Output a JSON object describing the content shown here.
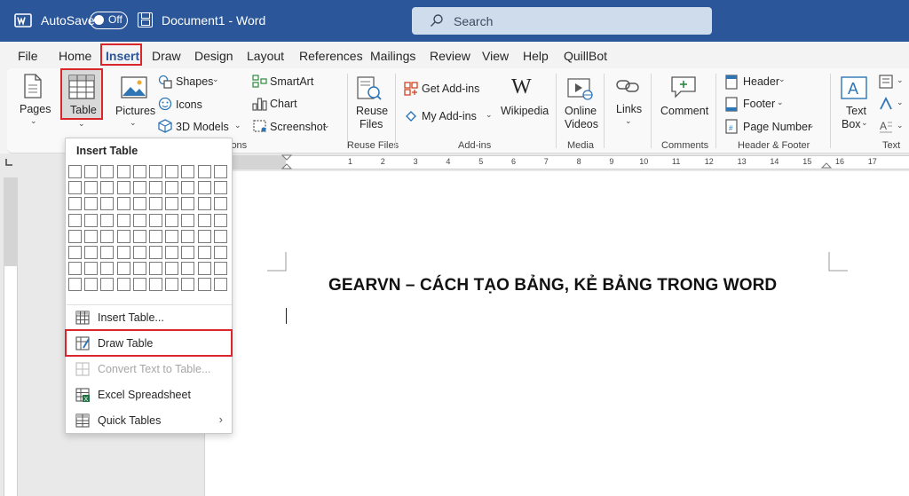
{
  "titlebar": {
    "autosave_label": "AutoSave",
    "toggle_state": "Off",
    "document_title": "Document1  -  Word",
    "search_placeholder": "Search"
  },
  "tabs": [
    {
      "label": "File"
    },
    {
      "label": "Home"
    },
    {
      "label": "Insert",
      "active": true
    },
    {
      "label": "Draw"
    },
    {
      "label": "Design"
    },
    {
      "label": "Layout"
    },
    {
      "label": "References"
    },
    {
      "label": "Mailings"
    },
    {
      "label": "Review"
    },
    {
      "label": "View"
    },
    {
      "label": "Help"
    },
    {
      "label": "QuillBot"
    }
  ],
  "ribbon": {
    "pages": "Pages",
    "table": "Table",
    "pictures": "Pictures",
    "shapes": "Shapes",
    "icons": "Icons",
    "models": "3D Models",
    "smartart": "SmartArt",
    "chart": "Chart",
    "screenshot": "Screenshot",
    "illustrations_group": "ions",
    "reuse_files": "Reuse",
    "reuse_files_2": "Files",
    "reuse_group": "Reuse Files",
    "get_addins": "Get Add-ins",
    "my_addins": "My Add-ins",
    "wikipedia": "Wikipedia",
    "addins_group": "Add-ins",
    "online_videos": "Online",
    "online_videos_2": "Videos",
    "media_group": "Media",
    "links": "Links",
    "comment": "Comment",
    "comments_group": "Comments",
    "header": "Header",
    "footer": "Footer",
    "page_number": "Page Number",
    "header_footer_group": "Header & Footer",
    "text_box": "Text",
    "text_box_2": "Box",
    "text_group": "Text"
  },
  "ruler": {
    "numbers": [
      "1",
      "2",
      "3",
      "4",
      "5",
      "6",
      "7",
      "8",
      "9",
      "10",
      "11",
      "12",
      "13",
      "14",
      "15",
      "16",
      "17"
    ]
  },
  "dropdown": {
    "title": "Insert Table",
    "grid_columns": 10,
    "grid_rows": 8,
    "items": [
      {
        "label": "Insert Table...",
        "icon": "table-grid-icon",
        "enabled": true
      },
      {
        "label": "Draw Table",
        "icon": "draw-table-icon",
        "enabled": true,
        "highlighted": true
      },
      {
        "label": "Convert Text to Table...",
        "icon": "convert-text-icon",
        "enabled": false
      },
      {
        "label": "Excel Spreadsheet",
        "icon": "excel-icon",
        "enabled": true
      },
      {
        "label": "Quick Tables",
        "icon": "quick-tables-icon",
        "enabled": true,
        "submenu": true
      }
    ]
  },
  "document": {
    "heading": "GEARVN – CÁCH TẠO BẢNG, KẺ BẢNG TRONG WORD"
  },
  "colors": {
    "titlebar": "#2b579a",
    "highlight": "#d9262a",
    "search_bg": "#cfdcec"
  }
}
